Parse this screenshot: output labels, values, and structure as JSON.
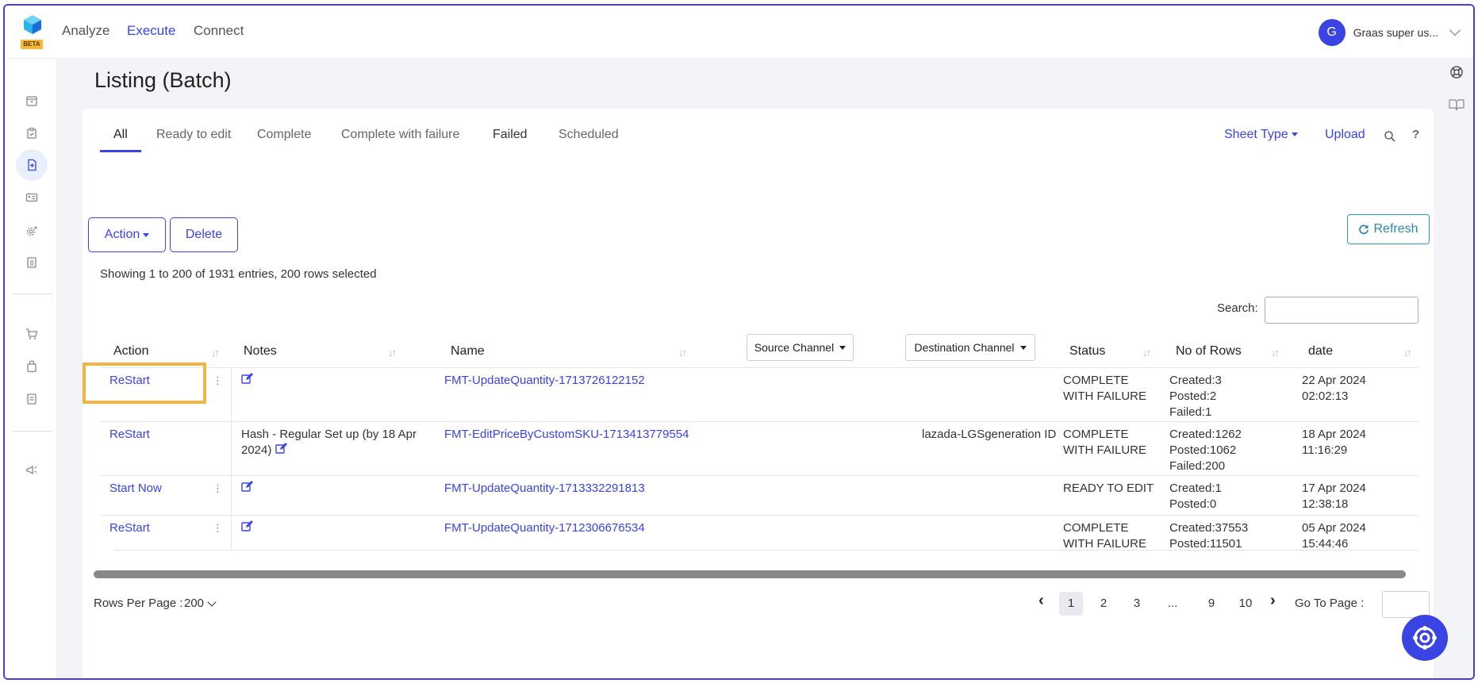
{
  "app": {
    "beta_badge": "BETA",
    "nav": [
      {
        "label": "Analyze"
      },
      {
        "label": "Execute"
      },
      {
        "label": "Connect"
      }
    ],
    "user": {
      "initial": "G",
      "name": "Graas super us..."
    }
  },
  "page": {
    "title": "Listing (Batch)"
  },
  "tabs": [
    {
      "label": "All"
    },
    {
      "label": "Ready to edit"
    },
    {
      "label": "Complete"
    },
    {
      "label": "Complete with failure"
    },
    {
      "label": "Failed"
    },
    {
      "label": "Scheduled"
    }
  ],
  "toolbar": {
    "sheet_type": "Sheet Type",
    "upload": "Upload",
    "action": "Action",
    "delete": "Delete",
    "refresh": "Refresh",
    "help": "?"
  },
  "entries_info": "Showing 1 to 200 of 1931 entries, 200 rows selected",
  "search": {
    "label": "Search:",
    "value": ""
  },
  "table": {
    "headers": {
      "action": "Action",
      "notes": "Notes",
      "name": "Name",
      "source_channel": "Source Channel",
      "destination_channel": "Destination Channel",
      "status": "Status",
      "no_of_rows": "No of Rows",
      "date": "date"
    },
    "rows": [
      {
        "action": "ReStart",
        "notes": "",
        "name": "FMT-UpdateQuantity-1713726122152",
        "destination": "",
        "status": [
          "COMPLETE",
          "WITH FAILURE"
        ],
        "rows_info": [
          "Created:3",
          "Posted:2",
          "Failed:1"
        ],
        "date": [
          "22 Apr 2024",
          "02:02:13"
        ]
      },
      {
        "action": "ReStart",
        "notes": [
          "Hash - Regular Set up (by 18 Apr",
          "2024)"
        ],
        "name": "FMT-EditPriceByCustomSKU-1713413779554",
        "destination": "lazada-LGSgeneration ID",
        "status": [
          "COMPLETE",
          "WITH FAILURE"
        ],
        "rows_info": [
          "Created:1262",
          "Posted:1062",
          "Failed:200"
        ],
        "date": [
          "18 Apr 2024",
          "11:16:29"
        ]
      },
      {
        "action": "Start Now",
        "notes": "",
        "name": "FMT-UpdateQuantity-1713332291813",
        "destination": "",
        "status": [
          "READY TO EDIT"
        ],
        "rows_info": [
          "Created:1",
          "Posted:0"
        ],
        "date": [
          "17 Apr 2024",
          "12:38:18"
        ]
      },
      {
        "action": "ReStart",
        "notes": "",
        "name": "FMT-UpdateQuantity-1712306676534",
        "destination": "",
        "status": [
          "COMPLETE",
          "WITH FAILURE"
        ],
        "rows_info": [
          "Created:37553",
          "Posted:11501"
        ],
        "date": [
          "05 Apr 2024",
          "15:44:46"
        ]
      }
    ]
  },
  "footer": {
    "rows_per_page_label": "Rows Per Page :",
    "rows_per_page_value": "200",
    "pages": [
      "1",
      "2",
      "3",
      "...",
      "9",
      "10"
    ],
    "current_page": "1",
    "goto_label": "Go To Page :"
  },
  "colors": {
    "accent": "#3a43e4",
    "highlight": "#f5b342",
    "beta": "#f6b93b",
    "refresh": "#2a87b8"
  },
  "icons": {
    "sidebar": [
      "archive-icon",
      "clipboard-check-icon",
      "file-upload-icon",
      "id-card-icon",
      "settings-gear-icon",
      "list-document-icon",
      "cart-icon",
      "shopping-bag-icon",
      "document-icon",
      "megaphone-icon"
    ]
  }
}
